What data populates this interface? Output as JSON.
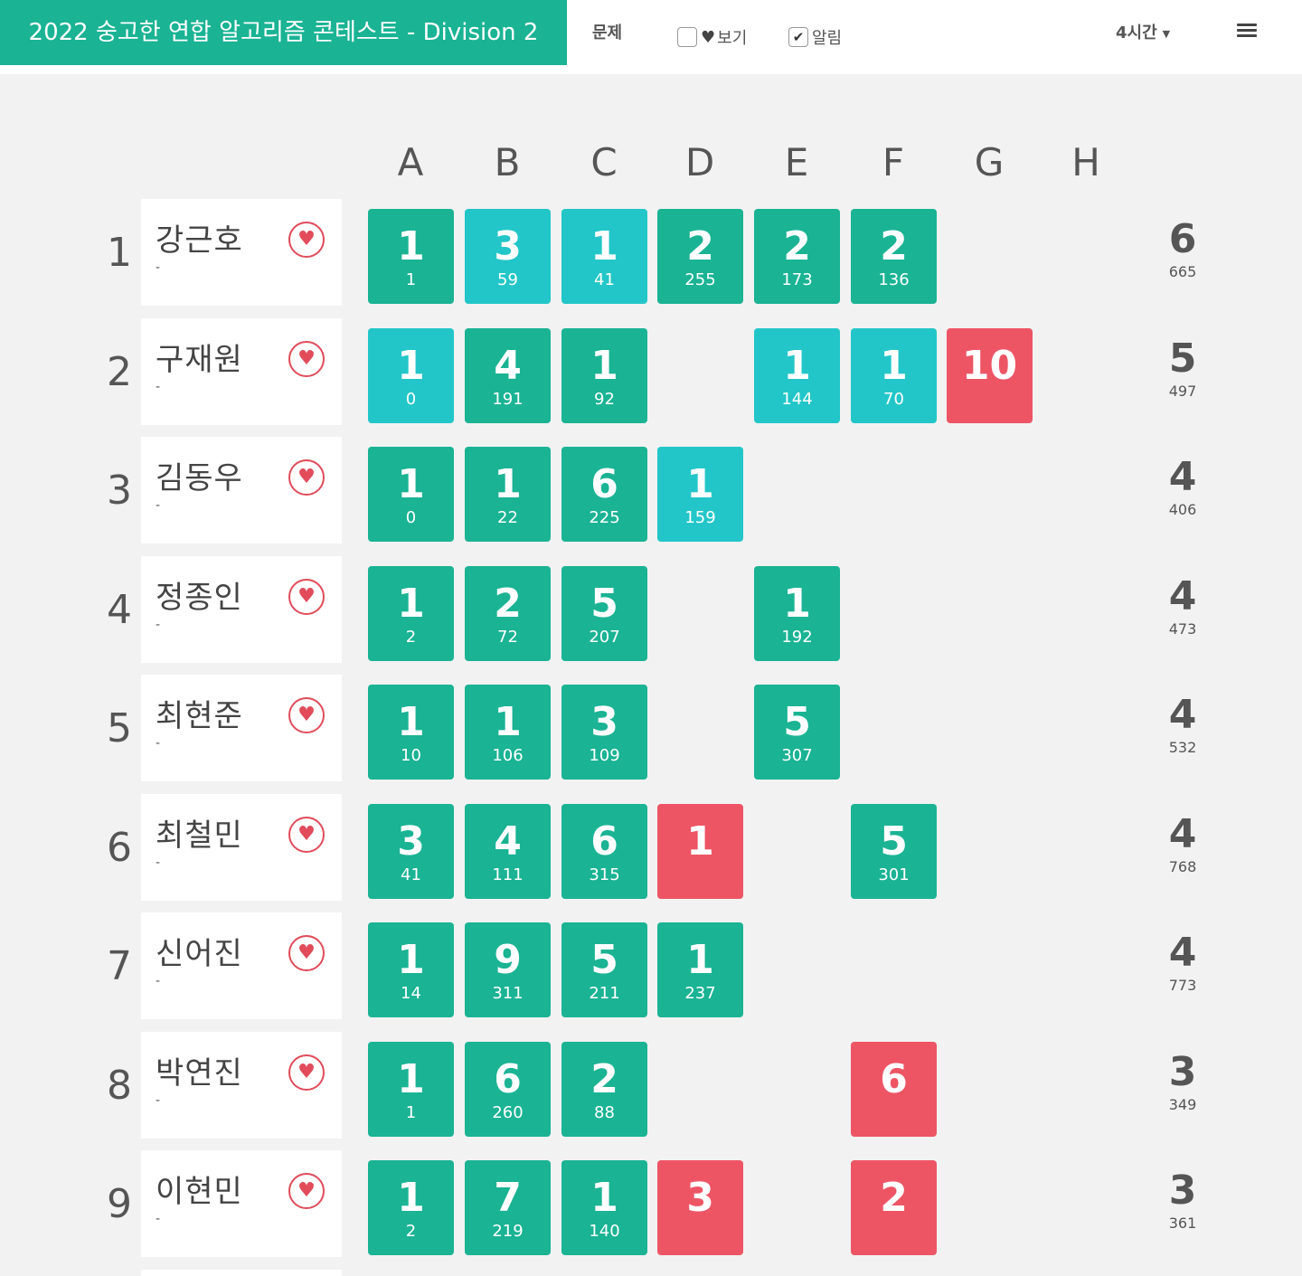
{
  "header": {
    "contest_title": "2022 숭고한 연합 알고리즘 콘테스트 - Division 2",
    "problems_link": "문제",
    "view_favorites_label": "보기",
    "view_favorites_checked": false,
    "notify_label": "알림",
    "notify_checked": true,
    "time_select": "4시간",
    "heart_icon": "heart-icon",
    "check_icon": "check-icon",
    "menu_icon": "menu-icon"
  },
  "colors": {
    "accent": "#1ab394",
    "first_solve": "#23c6c8",
    "failed": "#ed5565",
    "favorite": "#e14b5a"
  },
  "problems": [
    "A",
    "B",
    "C",
    "D",
    "E",
    "F",
    "G",
    "H"
  ],
  "rows": [
    {
      "rank": "1",
      "name": "강근호",
      "message": "-",
      "solved": "6",
      "penalty": "665",
      "cells": [
        {
          "tries": "1",
          "time": "1",
          "status": "accepted"
        },
        {
          "tries": "3",
          "time": "59",
          "status": "first"
        },
        {
          "tries": "1",
          "time": "41",
          "status": "first"
        },
        {
          "tries": "2",
          "time": "255",
          "status": "accepted"
        },
        {
          "tries": "2",
          "time": "173",
          "status": "accepted"
        },
        {
          "tries": "2",
          "time": "136",
          "status": "accepted"
        },
        null,
        null
      ]
    },
    {
      "rank": "2",
      "name": "구재원",
      "message": "-",
      "solved": "5",
      "penalty": "497",
      "cells": [
        {
          "tries": "1",
          "time": "0",
          "status": "first"
        },
        {
          "tries": "4",
          "time": "191",
          "status": "accepted"
        },
        {
          "tries": "1",
          "time": "92",
          "status": "accepted"
        },
        null,
        {
          "tries": "1",
          "time": "144",
          "status": "first"
        },
        {
          "tries": "1",
          "time": "70",
          "status": "first"
        },
        {
          "tries": "10",
          "time": "",
          "status": "failed"
        },
        null
      ]
    },
    {
      "rank": "3",
      "name": "김동우",
      "message": "-",
      "solved": "4",
      "penalty": "406",
      "cells": [
        {
          "tries": "1",
          "time": "0",
          "status": "accepted"
        },
        {
          "tries": "1",
          "time": "22",
          "status": "accepted"
        },
        {
          "tries": "6",
          "time": "225",
          "status": "accepted"
        },
        {
          "tries": "1",
          "time": "159",
          "status": "first"
        },
        null,
        null,
        null,
        null
      ]
    },
    {
      "rank": "4",
      "name": "정종인",
      "message": "-",
      "solved": "4",
      "penalty": "473",
      "cells": [
        {
          "tries": "1",
          "time": "2",
          "status": "accepted"
        },
        {
          "tries": "2",
          "time": "72",
          "status": "accepted"
        },
        {
          "tries": "5",
          "time": "207",
          "status": "accepted"
        },
        null,
        {
          "tries": "1",
          "time": "192",
          "status": "accepted"
        },
        null,
        null,
        null
      ]
    },
    {
      "rank": "5",
      "name": "최현준",
      "message": "-",
      "solved": "4",
      "penalty": "532",
      "cells": [
        {
          "tries": "1",
          "time": "10",
          "status": "accepted"
        },
        {
          "tries": "1",
          "time": "106",
          "status": "accepted"
        },
        {
          "tries": "3",
          "time": "109",
          "status": "accepted"
        },
        null,
        {
          "tries": "5",
          "time": "307",
          "status": "accepted"
        },
        null,
        null,
        null
      ]
    },
    {
      "rank": "6",
      "name": "최철민",
      "message": "-",
      "solved": "4",
      "penalty": "768",
      "cells": [
        {
          "tries": "3",
          "time": "41",
          "status": "accepted"
        },
        {
          "tries": "4",
          "time": "111",
          "status": "accepted"
        },
        {
          "tries": "6",
          "time": "315",
          "status": "accepted"
        },
        {
          "tries": "1",
          "time": "",
          "status": "failed"
        },
        null,
        {
          "tries": "5",
          "time": "301",
          "status": "accepted"
        },
        null,
        null
      ]
    },
    {
      "rank": "7",
      "name": "신어진",
      "message": "-",
      "solved": "4",
      "penalty": "773",
      "cells": [
        {
          "tries": "1",
          "time": "14",
          "status": "accepted"
        },
        {
          "tries": "9",
          "time": "311",
          "status": "accepted"
        },
        {
          "tries": "5",
          "time": "211",
          "status": "accepted"
        },
        {
          "tries": "1",
          "time": "237",
          "status": "accepted"
        },
        null,
        null,
        null,
        null
      ]
    },
    {
      "rank": "8",
      "name": "박연진",
      "message": "-",
      "solved": "3",
      "penalty": "349",
      "cells": [
        {
          "tries": "1",
          "time": "1",
          "status": "accepted"
        },
        {
          "tries": "6",
          "time": "260",
          "status": "accepted"
        },
        {
          "tries": "2",
          "time": "88",
          "status": "accepted"
        },
        null,
        null,
        {
          "tries": "6",
          "time": "",
          "status": "failed"
        },
        null,
        null
      ]
    },
    {
      "rank": "9",
      "name": "이현민",
      "message": "-",
      "solved": "3",
      "penalty": "361",
      "cells": [
        {
          "tries": "1",
          "time": "2",
          "status": "accepted"
        },
        {
          "tries": "7",
          "time": "219",
          "status": "accepted"
        },
        {
          "tries": "1",
          "time": "140",
          "status": "accepted"
        },
        {
          "tries": "3",
          "time": "",
          "status": "failed"
        },
        null,
        {
          "tries": "2",
          "time": "",
          "status": "failed"
        },
        null,
        null
      ]
    }
  ]
}
